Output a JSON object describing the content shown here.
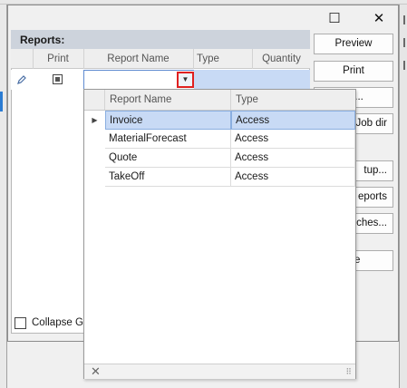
{
  "window": {
    "maximize_glyph": "☐",
    "close_glyph": "✕"
  },
  "reports_panel": {
    "title": "Reports:",
    "columns": [
      "Print",
      "Report Name",
      "Type",
      "Quantity"
    ],
    "edit_row": {
      "indicator_icon": "pencil-icon",
      "print_checked": true,
      "report_name": "",
      "type": "",
      "quantity": ""
    },
    "collapse_checkbox_label": "Collapse Gro"
  },
  "side_buttons": [
    {
      "label": "Preview"
    },
    {
      "label": "Print"
    },
    {
      "label": "...l..."
    },
    {
      "label": "Job dir"
    },
    {
      "label": "tup..."
    },
    {
      "label": "eports"
    },
    {
      "label": "ches..."
    },
    {
      "label": "e"
    }
  ],
  "dropdown": {
    "columns": [
      "Report Name",
      "Type"
    ],
    "rows": [
      {
        "name": "Invoice",
        "type": "Access",
        "selected": true
      },
      {
        "name": "MaterialForecast",
        "type": "Access",
        "selected": false
      },
      {
        "name": "Quote",
        "type": "Access",
        "selected": false
      },
      {
        "name": "TakeOff",
        "type": "Access",
        "selected": false
      }
    ],
    "footer_close": "✕",
    "resize_grip": "⠿"
  },
  "colors": {
    "selection": "#c8daf5",
    "highlight_border": "#e02020",
    "panel_header": "#cdd3dc"
  }
}
